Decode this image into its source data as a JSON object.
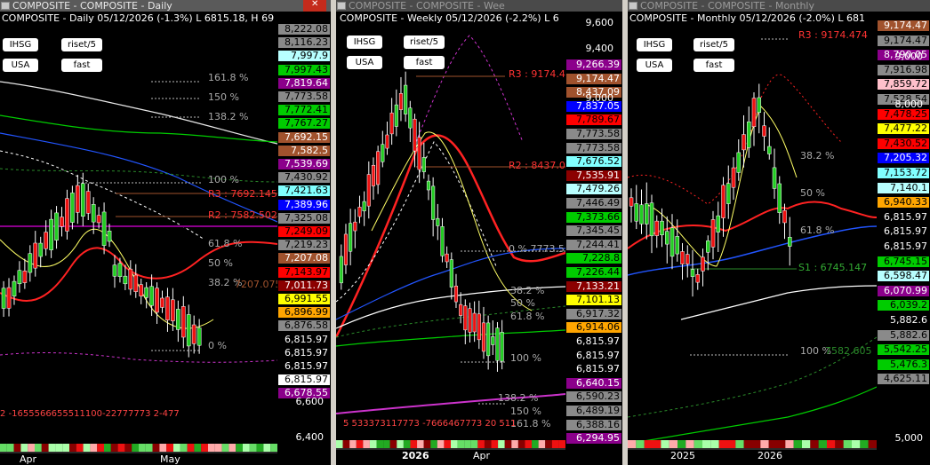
{
  "panels": [
    {
      "window_title": "COMPOSITE - COMPOSITE - Daily",
      "chart_title": "COMPOSITE - Daily 05/12/2026 (-1.3%) L 6815.18, H 69",
      "buttons": [
        "IHSG",
        "riset/5",
        "USA",
        "fast"
      ],
      "fib_labels": [
        "161.8 %",
        "150 %",
        "138.2 %",
        "100 %",
        "61.8 %",
        "50 %",
        "38.2 %",
        "0 %"
      ],
      "level_labels": [
        "R3 : 7692.145",
        "R2 : 7582.502",
        "7207.075"
      ],
      "price_tags": [
        {
          "t": "8,222.08",
          "bg": "#8a8a8a",
          "fg": "#000"
        },
        {
          "t": "8,116.23",
          "bg": "#8a8a8a",
          "fg": "#000"
        },
        {
          "t": "7,997.9",
          "bg": "#b8ffff",
          "fg": "#000"
        },
        {
          "t": "7,997.43",
          "bg": "#00cc00",
          "fg": "#000"
        },
        {
          "t": "7,819.64",
          "bg": "#8b008b",
          "fg": "#fff"
        },
        {
          "t": "7,773.58",
          "bg": "#8a8a8a",
          "fg": "#000"
        },
        {
          "t": "7,772.41",
          "bg": "#00cc00",
          "fg": "#000"
        },
        {
          "t": "7,767.27",
          "bg": "#00cc00",
          "fg": "#000"
        },
        {
          "t": "7,692.15",
          "bg": "#a0522d",
          "fg": "#fff"
        },
        {
          "t": "7,582.5",
          "bg": "#a0522d",
          "fg": "#fff"
        },
        {
          "t": "7,539.69",
          "bg": "#8b008b",
          "fg": "#fff"
        },
        {
          "t": "7,430.92",
          "bg": "#8a8a8a",
          "fg": "#000"
        },
        {
          "t": "7,421.63",
          "bg": "#80ffff",
          "fg": "#000"
        },
        {
          "t": "7,389.96",
          "bg": "#0000ff",
          "fg": "#fff"
        },
        {
          "t": "7,325.08",
          "bg": "#8a8a8a",
          "fg": "#000"
        },
        {
          "t": "7,249.09",
          "bg": "#ff0000",
          "fg": "#000"
        },
        {
          "t": "7,219.23",
          "bg": "#8a8a8a",
          "fg": "#000"
        },
        {
          "t": "7,207.08",
          "bg": "#a0522d",
          "fg": "#fff"
        },
        {
          "t": "7,143.97",
          "bg": "#ff0000",
          "fg": "#000"
        },
        {
          "t": "7,011.73",
          "bg": "#8b0000",
          "fg": "#fff"
        },
        {
          "t": "6,991.55",
          "bg": "#ffff00",
          "fg": "#000"
        },
        {
          "t": "6,896.99",
          "bg": "#ffa500",
          "fg": "#000"
        },
        {
          "t": "6,876.58",
          "bg": "#8a8a8a",
          "fg": "#000"
        },
        {
          "t": "6,815.97",
          "bg": "#000",
          "fg": "#fff"
        },
        {
          "t": "6,815.97",
          "bg": "#000",
          "fg": "#fff"
        },
        {
          "t": "6,815.97",
          "bg": "#000",
          "fg": "#fff"
        },
        {
          "t": "6,815.97",
          "bg": "#fff",
          "fg": "#000"
        },
        {
          "t": "6,678.55",
          "bg": "#8b008b",
          "fg": "#fff"
        }
      ],
      "axis_labels": [
        "6,600",
        "6,400"
      ],
      "x_labels": [
        "Apr",
        "May"
      ],
      "signal_text": "2 -1655566655511100-22777773 2-477"
    },
    {
      "window_title": "COMPOSITE - COMPOSITE - Wee",
      "chart_title": "COMPOSITE - Weekly 05/12/2026 (-2.2%) L 6",
      "buttons": [
        "IHSG",
        "riset/5",
        "USA",
        "fast"
      ],
      "fib_labels": [
        "38.2 %",
        "50 %",
        "61.8 %",
        "100 %",
        "138.2 %",
        "150 %",
        "161.8 %"
      ],
      "level_labels": [
        "R3 : 9174.4",
        "R2 : 8437.0",
        "0 % 7773.5"
      ],
      "price_tags": [
        {
          "t": "9,266.39",
          "bg": "#8b008b",
          "fg": "#fff"
        },
        {
          "t": "9,174.47",
          "bg": "#a0522d",
          "fg": "#fff"
        },
        {
          "t": "8,437.09",
          "bg": "#a0522d",
          "fg": "#fff"
        },
        {
          "t": "7,837.05",
          "bg": "#0000ff",
          "fg": "#fff"
        },
        {
          "t": "7,789.67",
          "bg": "#ff0000",
          "fg": "#000"
        },
        {
          "t": "7,773.58",
          "bg": "#8a8a8a",
          "fg": "#000"
        },
        {
          "t": "7,773.58",
          "bg": "#8a8a8a",
          "fg": "#000"
        },
        {
          "t": "7,676.52",
          "bg": "#80ffff",
          "fg": "#000"
        },
        {
          "t": "7,535.91",
          "bg": "#8b0000",
          "fg": "#fff"
        },
        {
          "t": "7,479.26",
          "bg": "#b8ffff",
          "fg": "#000"
        },
        {
          "t": "7,446.49",
          "bg": "#8a8a8a",
          "fg": "#000"
        },
        {
          "t": "7,373.66",
          "bg": "#00cc00",
          "fg": "#000"
        },
        {
          "t": "7,345.45",
          "bg": "#8a8a8a",
          "fg": "#000"
        },
        {
          "t": "7,244.41",
          "bg": "#8a8a8a",
          "fg": "#000"
        },
        {
          "t": "7,228.8",
          "bg": "#00cc00",
          "fg": "#000"
        },
        {
          "t": "7,226.44",
          "bg": "#00cc00",
          "fg": "#000"
        },
        {
          "t": "7,133.21",
          "bg": "#8b0000",
          "fg": "#fff"
        },
        {
          "t": "7,101.13",
          "bg": "#ffff00",
          "fg": "#000"
        },
        {
          "t": "6,917.32",
          "bg": "#8a8a8a",
          "fg": "#000"
        },
        {
          "t": "6,914.06",
          "bg": "#ffa500",
          "fg": "#000"
        },
        {
          "t": "6,815.97",
          "bg": "#000",
          "fg": "#fff"
        },
        {
          "t": "6,815.97",
          "bg": "#000",
          "fg": "#fff"
        },
        {
          "t": "6,815.97",
          "bg": "#000",
          "fg": "#fff"
        },
        {
          "t": "6,640.15",
          "bg": "#8b008b",
          "fg": "#fff"
        },
        {
          "t": "6,590.23",
          "bg": "#8a8a8a",
          "fg": "#000"
        },
        {
          "t": "6,489.19",
          "bg": "#8a8a8a",
          "fg": "#000"
        },
        {
          "t": "6,388.16",
          "bg": "#8a8a8a",
          "fg": "#000"
        },
        {
          "t": "6,294.95",
          "bg": "#8b008b",
          "fg": "#fff"
        }
      ],
      "axis_labels": [
        "9,600",
        "9,400",
        "9,000"
      ],
      "x_labels": [
        "2026",
        "Apr"
      ],
      "signal_text": "5 533373117773 -7666467773 20 511"
    },
    {
      "window_title": "COMPOSITE - COMPOSITE - Monthly",
      "chart_title": "COMPOSITE - Monthly 05/12/2026 (-2.0%) L 681",
      "buttons": [
        "IHSG",
        "riset/5",
        "USA",
        "fast"
      ],
      "fib_labels": [
        "38.2 %",
        "50 %",
        "61.8 %",
        "100 %"
      ],
      "level_labels": [
        "R3 : 9174.474",
        "S1 : 6745.147",
        "7582.605"
      ],
      "price_tags": [
        {
          "t": "9,174.47",
          "bg": "#a0522d",
          "fg": "#fff"
        },
        {
          "t": "9,174.47",
          "bg": "#8a8a8a",
          "fg": "#000"
        },
        {
          "t": "8,790.05",
          "bg": "#8b008b",
          "fg": "#fff"
        },
        {
          "t": "7,916.98",
          "bg": "#8a8a8a",
          "fg": "#000"
        },
        {
          "t": "7,859.72",
          "bg": "#ffc0cb",
          "fg": "#000"
        },
        {
          "t": "7,528.54",
          "bg": "#8a8a8a",
          "fg": "#000"
        },
        {
          "t": "7,478.25",
          "bg": "#ff0000",
          "fg": "#000"
        },
        {
          "t": "7,477.22",
          "bg": "#ffff00",
          "fg": "#000"
        },
        {
          "t": "7,430.52",
          "bg": "#ff0000",
          "fg": "#000"
        },
        {
          "t": "7,205.32",
          "bg": "#0000ff",
          "fg": "#fff"
        },
        {
          "t": "7,153.72",
          "bg": "#80ffff",
          "fg": "#000"
        },
        {
          "t": "7,140.1",
          "bg": "#b8ffff",
          "fg": "#000"
        },
        {
          "t": "6,940.33",
          "bg": "#ffa500",
          "fg": "#000"
        },
        {
          "t": "6,815.97",
          "bg": "#000",
          "fg": "#fff"
        },
        {
          "t": "6,815.97",
          "bg": "#000",
          "fg": "#fff"
        },
        {
          "t": "6,815.97",
          "bg": "#000",
          "fg": "#fff"
        },
        {
          "t": "6,745.15",
          "bg": "#00cc00",
          "fg": "#000"
        },
        {
          "t": "6,598.47",
          "bg": "#b8ffff",
          "fg": "#000"
        },
        {
          "t": "6,070.99",
          "bg": "#8b008b",
          "fg": "#fff"
        },
        {
          "t": "6,039.2",
          "bg": "#00cc00",
          "fg": "#000"
        },
        {
          "t": "5,882.6",
          "bg": "#000",
          "fg": "#fff"
        },
        {
          "t": "5,882.6",
          "bg": "#8a8a8a",
          "fg": "#000"
        },
        {
          "t": "5,542.25",
          "bg": "#00cc00",
          "fg": "#000"
        },
        {
          "t": "5,476.3",
          "bg": "#00cc00",
          "fg": "#000"
        },
        {
          "t": "4,625.11",
          "bg": "#8a8a8a",
          "fg": "#000"
        }
      ],
      "axis_labels": [
        "9,000",
        "8,000",
        "5,000"
      ],
      "x_labels": [
        "2025",
        "2026"
      ],
      "signal_text": ""
    }
  ]
}
